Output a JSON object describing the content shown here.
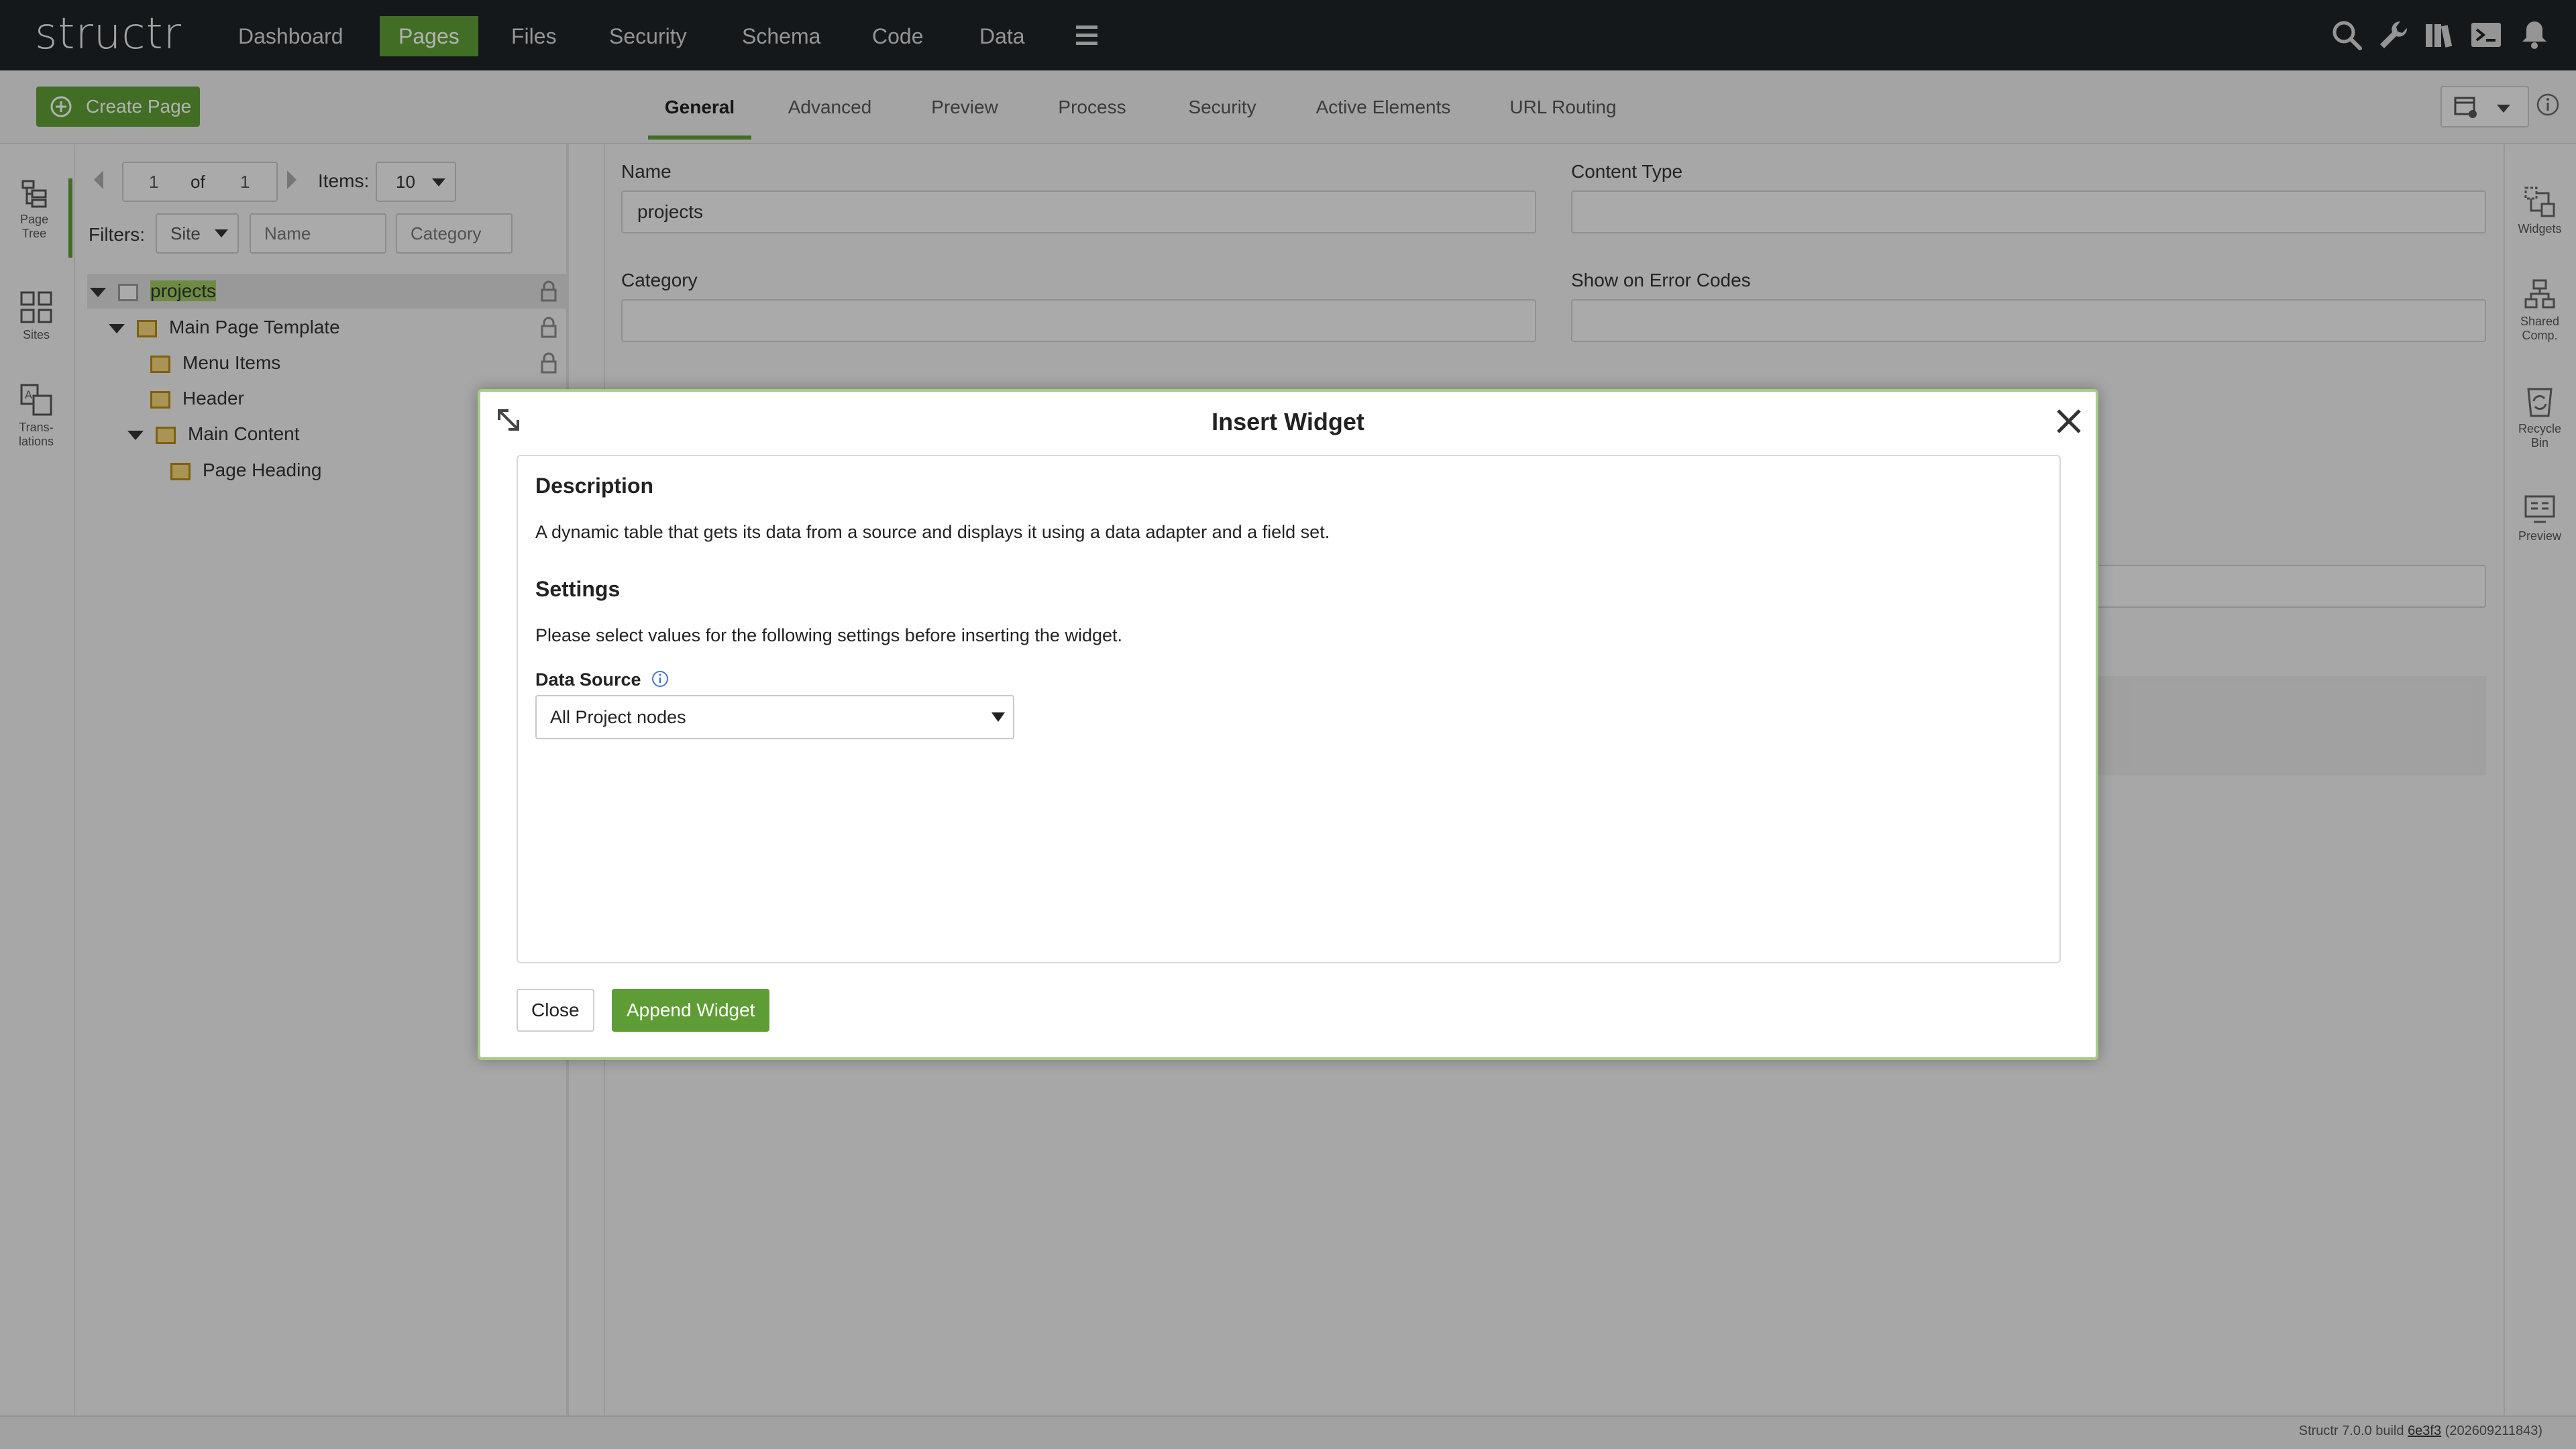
{
  "app": {
    "logo": "structr",
    "nav": [
      "Dashboard",
      "Pages",
      "Files",
      "Security",
      "Schema",
      "Code",
      "Data"
    ],
    "active_nav": "Pages",
    "menu_icon": "hamburger-icon",
    "top_icons": [
      "search-icon",
      "wrench-icon",
      "book-icon",
      "terminal-icon",
      "bell-icon"
    ]
  },
  "toolbar": {
    "create_page": "Create Page",
    "tabs": [
      "General",
      "Advanced",
      "Preview",
      "Process",
      "Security",
      "Active Elements",
      "URL Routing"
    ],
    "active_tab": "General"
  },
  "left_sidebar": {
    "items": [
      {
        "label_1": "Page",
        "label_2": "Tree",
        "icon": "page-tree-icon"
      },
      {
        "label_1": "Sites",
        "label_2": "",
        "icon": "sites-icon"
      },
      {
        "label_1": "Trans-",
        "label_2": "lations",
        "icon": "translations-icon"
      }
    ]
  },
  "tree": {
    "pager": {
      "page": "1",
      "of_label": "of",
      "total": "1",
      "items_label": "Items:",
      "items_value": "10"
    },
    "filters": {
      "label": "Filters:",
      "site": "Site",
      "name_placeholder": "Name",
      "category_placeholder": "Category"
    },
    "nodes": [
      {
        "label": "projects",
        "level": 0
      },
      {
        "label": "Main Page Template",
        "level": 1
      },
      {
        "label": "Menu Items",
        "level": 2
      },
      {
        "label": "Header",
        "level": 2
      },
      {
        "label": "Main Content",
        "level": 2
      },
      {
        "label": "Page Heading",
        "level": 3
      }
    ]
  },
  "form": {
    "name_label": "Name",
    "name_value": "projects",
    "content_type_label": "Content Type",
    "category_label": "Category",
    "error_codes_label": "Show on Error Codes"
  },
  "right_sidebar": {
    "items": [
      {
        "label_1": "Widgets",
        "label_2": "",
        "icon": "widgets-icon"
      },
      {
        "label_1": "Shared",
        "label_2": "Comp.",
        "icon": "shared-components-icon"
      },
      {
        "label_1": "Recycle",
        "label_2": "Bin",
        "icon": "recycle-bin-icon"
      },
      {
        "label_1": "Preview",
        "label_2": "",
        "icon": "preview-icon"
      }
    ]
  },
  "dialog": {
    "title": "Insert Widget",
    "description_heading": "Description",
    "description_text": "A dynamic table that gets its data from a source and displays it using a data adapter and a field set.",
    "settings_heading": "Settings",
    "settings_text": "Please select values for the following settings before inserting the widget.",
    "data_source_label": "Data Source",
    "data_source_value": "All Project nodes",
    "close_button": "Close",
    "append_button": "Append Widget"
  },
  "footer": {
    "version": "Structr 7.0.0 build",
    "build_link": "6e3f3",
    "build_date": "(202609211843)"
  },
  "colors": {
    "accent": "#5e9d35",
    "topbar": "#1f2328",
    "node": "#f2d57a"
  }
}
